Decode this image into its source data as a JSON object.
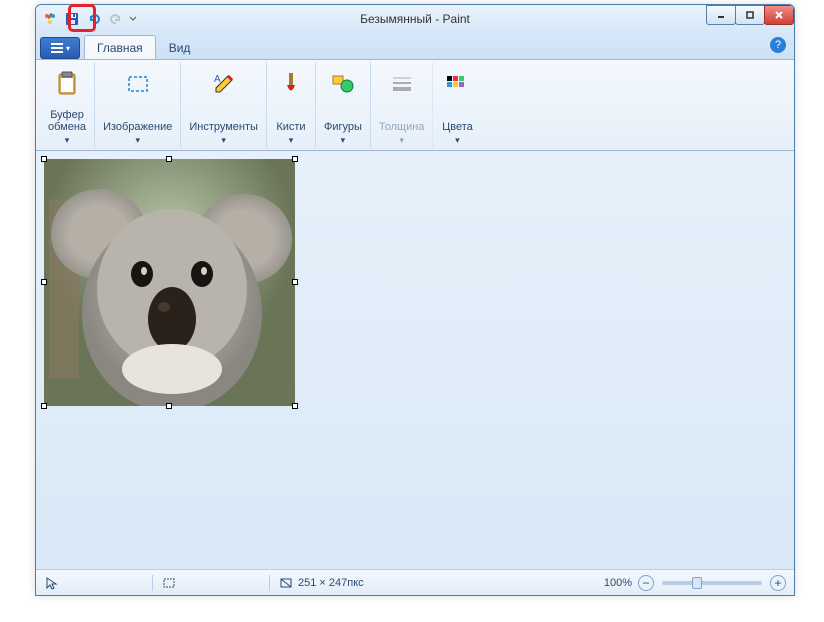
{
  "title": "Безымянный - Paint",
  "qat": {
    "app_icon": "paint",
    "save": "save",
    "undo": "undo",
    "redo": "redo"
  },
  "file_menu_label": "",
  "tabs": [
    {
      "label": "Главная",
      "active": true
    },
    {
      "label": "Вид",
      "active": false
    }
  ],
  "ribbon_groups": [
    {
      "id": "clipboard",
      "label": "Буфер\nобмена",
      "icon": "clipboard",
      "dropdown": true,
      "enabled": true
    },
    {
      "id": "image",
      "label": "Изображение",
      "icon": "select-rect",
      "dropdown": true,
      "enabled": true
    },
    {
      "id": "tools",
      "label": "Инструменты",
      "icon": "pencil",
      "dropdown": true,
      "enabled": true
    },
    {
      "id": "brushes",
      "label": "Кисти",
      "icon": "brush",
      "dropdown": true,
      "enabled": true
    },
    {
      "id": "shapes",
      "label": "Фигуры",
      "icon": "shapes",
      "dropdown": true,
      "enabled": true
    },
    {
      "id": "size",
      "label": "Толщина",
      "icon": "line-weight",
      "dropdown": true,
      "enabled": false
    },
    {
      "id": "colors",
      "label": "Цвета",
      "icon": "colors",
      "dropdown": true,
      "enabled": true
    }
  ],
  "canvas": {
    "image_description": "koala photograph",
    "selection_size": "251 × 247пкс"
  },
  "statusbar": {
    "cursor_pos": "",
    "selection": "",
    "canvas_size": "251 × 247пкс",
    "zoom": "100%"
  },
  "colors": {
    "accent": "#2a5db0",
    "highlight": "#e6202c"
  }
}
